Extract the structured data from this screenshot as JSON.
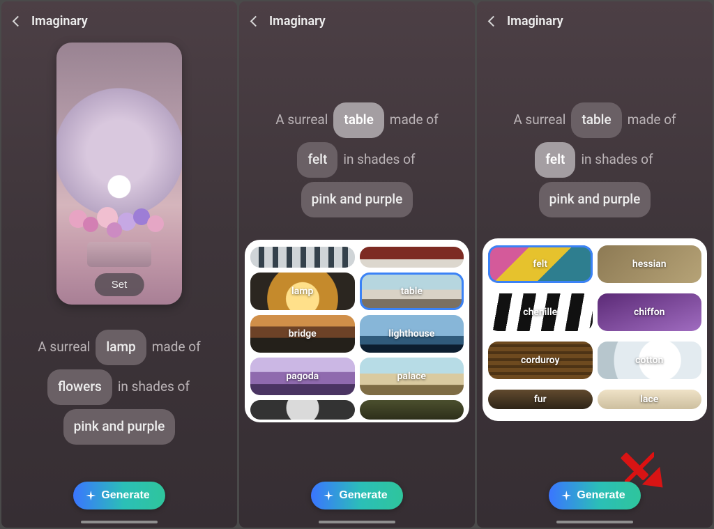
{
  "app_title": "Imaginary",
  "set_label": "Set",
  "generate_label": "Generate",
  "panel1": {
    "prompt": {
      "t1": "A surreal",
      "pill1": "lamp",
      "t2": "made of",
      "pill2": "flowers",
      "t3": "in shades of",
      "pill3": "pink and purple"
    }
  },
  "panel2": {
    "prompt": {
      "t1": "A surreal",
      "pill1": "table",
      "t2": "made of",
      "pill2": "felt",
      "t3": "in shades of",
      "pill3": "pink and purple"
    },
    "selected_pill": "table",
    "options": [
      "lamp",
      "table",
      "bridge",
      "lighthouse",
      "pagoda",
      "palace"
    ],
    "selected_option": "table"
  },
  "panel3": {
    "prompt": {
      "t1": "A surreal",
      "pill1": "table",
      "t2": "made of",
      "pill2": "felt",
      "t3": "in shades of",
      "pill3": "pink and purple"
    },
    "selected_pill": "felt",
    "options": [
      "felt",
      "hessian",
      "chenille",
      "chiffon",
      "corduroy",
      "cotton",
      "fur",
      "lace"
    ],
    "selected_option": "felt"
  }
}
